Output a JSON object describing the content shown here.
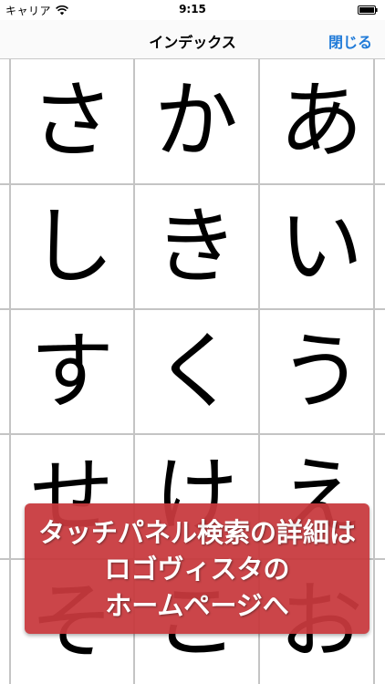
{
  "status_bar": {
    "carrier": "キャリア",
    "time": "9:15"
  },
  "nav": {
    "title": "インデックス",
    "close_label": "閉じる"
  },
  "grid": {
    "cells": [
      "さ",
      "か",
      "あ",
      "し",
      "き",
      "い",
      "す",
      "く",
      "う",
      "せ",
      "け",
      "え",
      "そ",
      "こ",
      "お"
    ]
  },
  "banner": {
    "lines": [
      "タッチパネル検索の詳細は",
      "ロゴヴィスタの",
      "ホームページへ"
    ]
  },
  "colors": {
    "accent": "#1f7ad8",
    "banner": "#c83a3e",
    "grid_line": "#c4c4c4"
  }
}
